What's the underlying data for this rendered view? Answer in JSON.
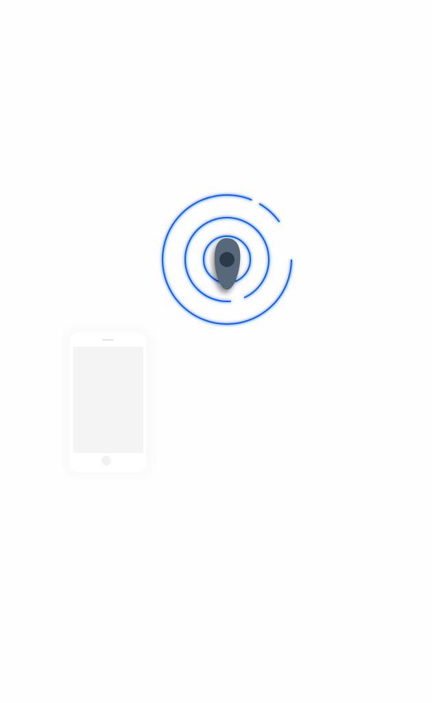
{
  "colors": {
    "ring": "#0a5cf5",
    "device_body": "#56687a",
    "device_dot": "#2a3a4a",
    "phone_screen": "#f4f4f4"
  },
  "icons": {
    "scanner": "bluetooth-scan-rings-icon",
    "device": "remote-device-icon",
    "phone": "smartphone-icon"
  }
}
